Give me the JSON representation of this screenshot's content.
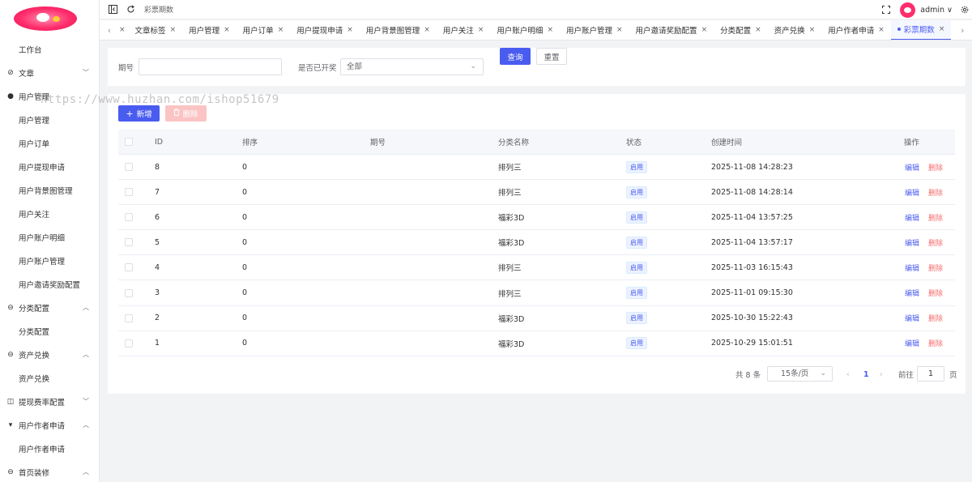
{
  "colors": {
    "primary": "#4a5cf0",
    "danger": "#f56c6c",
    "brand": "#ff2d6b"
  },
  "sidebar": {
    "items": [
      {
        "label": "工作台",
        "level": "top",
        "icon": "",
        "arrow": ""
      },
      {
        "label": "文章",
        "level": "top",
        "icon": "compass-icon",
        "arrow": "down"
      },
      {
        "label": "用户管理",
        "level": "top",
        "icon": "user-icon",
        "arrow": ""
      },
      {
        "label": "用户管理",
        "level": "sub"
      },
      {
        "label": "用户订单",
        "level": "sub"
      },
      {
        "label": "用户提现申请",
        "level": "sub"
      },
      {
        "label": "用户背景图管理",
        "level": "sub"
      },
      {
        "label": "用户关注",
        "level": "sub"
      },
      {
        "label": "用户账户明细",
        "level": "sub"
      },
      {
        "label": "用户账户管理",
        "level": "sub"
      },
      {
        "label": "用户邀请奖励配置",
        "level": "sub"
      },
      {
        "label": "分类配置",
        "level": "top",
        "icon": "database-icon",
        "arrow": "up"
      },
      {
        "label": "分类配置",
        "level": "sub"
      },
      {
        "label": "资产兑换",
        "level": "top",
        "icon": "database-icon",
        "arrow": "up"
      },
      {
        "label": "资产兑换",
        "level": "sub"
      },
      {
        "label": "提现费率配置",
        "level": "top",
        "icon": "camera-icon",
        "arrow": "down"
      },
      {
        "label": "用户作者申请",
        "level": "top",
        "icon": "pin-icon",
        "arrow": "up"
      },
      {
        "label": "用户作者申请",
        "level": "sub"
      },
      {
        "label": "首页装修",
        "level": "top",
        "icon": "database-icon",
        "arrow": "up"
      }
    ]
  },
  "topbar": {
    "breadcrumb": "彩票期数",
    "user": "admin ∨"
  },
  "tabs": [
    {
      "label": "文章标签"
    },
    {
      "label": "用户管理"
    },
    {
      "label": "用户订单"
    },
    {
      "label": "用户提现申请"
    },
    {
      "label": "用户背景图管理"
    },
    {
      "label": "用户关注"
    },
    {
      "label": "用户账户明细"
    },
    {
      "label": "用户账户管理"
    },
    {
      "label": "用户邀请奖励配置"
    },
    {
      "label": "分类配置"
    },
    {
      "label": "资产兑换"
    },
    {
      "label": "用户作者申请"
    },
    {
      "label": "彩票期数",
      "active": true
    }
  ],
  "search": {
    "period_label": "期号",
    "period_value": "",
    "drawn_label": "是否已开奖",
    "drawn_value": "全部",
    "query_button": "查询",
    "reset_button": "重置"
  },
  "toolbar": {
    "add_button": "新增",
    "delete_button": "删除"
  },
  "watermark": "https://www.huzhan.com/ishop51679",
  "table": {
    "headers": {
      "id": "ID",
      "sort": "排序",
      "period": "期号",
      "category": "分类名称",
      "status": "状态",
      "created": "创建时间",
      "actions": "操作"
    },
    "rows": [
      {
        "id": "8",
        "sort": "0",
        "period": "",
        "category": "排列三",
        "status": "启用",
        "created": "2025-11-08 14:28:23",
        "edit": "编辑",
        "del": "删除"
      },
      {
        "id": "7",
        "sort": "0",
        "period": "",
        "category": "排列三",
        "status": "启用",
        "created": "2025-11-08 14:28:14",
        "edit": "编辑",
        "del": "删除"
      },
      {
        "id": "6",
        "sort": "0",
        "period": "",
        "category": "福彩3D",
        "status": "启用",
        "created": "2025-11-04 13:57:25",
        "edit": "编辑",
        "del": "删除"
      },
      {
        "id": "5",
        "sort": "0",
        "period": "",
        "category": "福彩3D",
        "status": "启用",
        "created": "2025-11-04 13:57:17",
        "edit": "编辑",
        "del": "删除"
      },
      {
        "id": "4",
        "sort": "0",
        "period": "",
        "category": "排列三",
        "status": "启用",
        "created": "2025-11-03 16:15:43",
        "edit": "编辑",
        "del": "删除"
      },
      {
        "id": "3",
        "sort": "0",
        "period": "",
        "category": "排列三",
        "status": "启用",
        "created": "2025-11-01 09:15:30",
        "edit": "编辑",
        "del": "删除"
      },
      {
        "id": "2",
        "sort": "0",
        "period": "",
        "category": "福彩3D",
        "status": "启用",
        "created": "2025-10-30 15:22:43",
        "edit": "编辑",
        "del": "删除"
      },
      {
        "id": "1",
        "sort": "0",
        "period": "",
        "category": "福彩3D",
        "status": "启用",
        "created": "2025-10-29 15:01:51",
        "edit": "编辑",
        "del": "删除"
      }
    ]
  },
  "pagination": {
    "total": "共 8 条",
    "page_size": "15条/页",
    "current": "1",
    "goto_label": "前往",
    "goto_value": "1",
    "page_suffix": "页"
  }
}
